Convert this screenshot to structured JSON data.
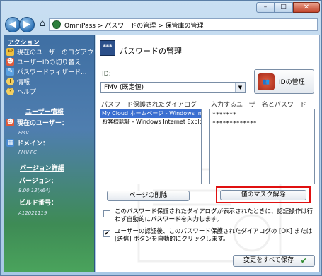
{
  "window": {
    "minimize_glyph": "–",
    "maximize_glyph": "□",
    "close_glyph": "✕"
  },
  "nav": {
    "back_glyph": "◀",
    "forward_glyph": "▶",
    "home_glyph": "⌂",
    "breadcrumb": "OmniPass > パスワードの管理 > 保管庫の管理"
  },
  "sidebar": {
    "actions_heading": "アクション",
    "actions": [
      {
        "label": "現在のユーザーのログアウト",
        "icon": "logout-icon"
      },
      {
        "label": "ユーザーIDの切り替え",
        "icon": "switch-user-icon"
      },
      {
        "label": "パスワードウィザード...",
        "icon": "wizard-icon"
      },
      {
        "label": "情報",
        "icon": "info-icon"
      },
      {
        "label": "ヘルプ",
        "icon": "help-icon"
      }
    ],
    "user_info_heading": "ユーザー情報",
    "current_user_label": "現在のユーザー：",
    "current_user_value": "FMV",
    "domain_label": "ドメイン：",
    "domain_value": "FMV-PC",
    "version_heading": "バージョン詳細",
    "version_label": "バージョン：",
    "version_value": "8.00.13(x64)",
    "build_label": "ビルド番号：",
    "build_value": "A12021119"
  },
  "main": {
    "title": "パスワードの管理",
    "id_label": "ID:",
    "id_selected": "FMV (既定値)",
    "id_manage_button": "IDの管理",
    "dialogs_label": "パスワード保護されたダイアログ",
    "credentials_label": "入力するユーザー名とパスワード",
    "dialogs": [
      {
        "label": "My Cloud ホームページ - Windows In",
        "selected": true
      },
      {
        "label": "お客様認証 - Windows Internet Explo",
        "selected": false
      }
    ],
    "credentials": [
      "*******",
      "*************"
    ],
    "delete_page_button": "ページの削除",
    "unmask_button": "値のマスク解除",
    "option1_text": "このパスワード保護されたダイアログが表示されたときに、認証操作は行わず自動的にパスワードを入力します。",
    "option1_checked": false,
    "option2_text": "ユーザーの認証後、このパスワード保護されたダイアログの [OK] または [送信] ボタンを自動的にクリックします。",
    "option2_checked": true,
    "save_all_button": "変更をすべて保存",
    "save_check_glyph": "✔"
  },
  "colors": {
    "highlight": "#e01010",
    "selection": "#3b6fd1",
    "sidebar_top": "#3f6fa3",
    "sidebar_bottom": "#4aa35c"
  }
}
